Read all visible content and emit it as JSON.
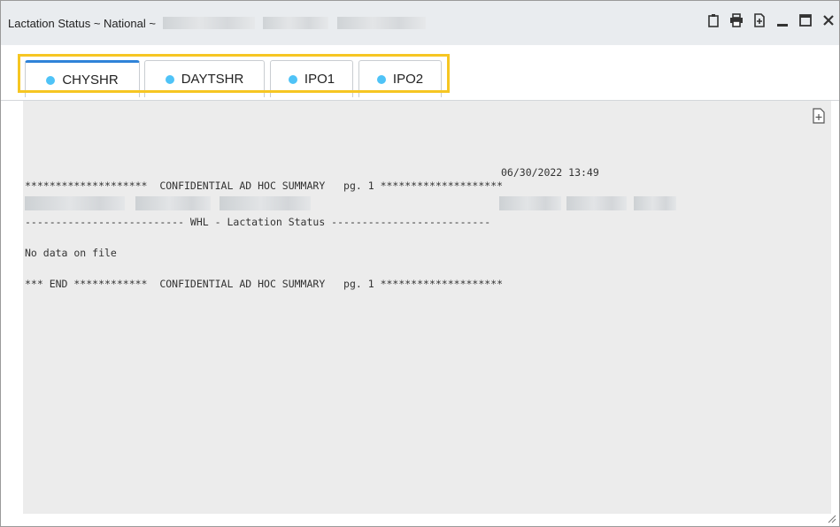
{
  "window": {
    "title": "Lactation Status ~ National ~",
    "title_redacted": true,
    "icons": [
      "clipboard-icon",
      "printer-icon",
      "export-icon",
      "minimize-icon",
      "maximize-icon",
      "close-icon"
    ]
  },
  "tabs": [
    {
      "label": "CHYSHR",
      "active": true
    },
    {
      "label": "DAYTSHR",
      "active": false
    },
    {
      "label": "IPO1",
      "active": false
    },
    {
      "label": "IPO2",
      "active": false
    }
  ],
  "report": {
    "datetime": "06/30/2022 13:49",
    "header_line": "********************  CONFIDENTIAL AD HOC SUMMARY   pg. 1 ********************",
    "section_line": "-------------------------- WHL - Lactation Status --------------------------",
    "empty_message": "No data on file",
    "footer_line": "*** END ************  CONFIDENTIAL AD HOC SUMMARY   pg. 1 ********************"
  },
  "colors": {
    "accent": "#2f83d8",
    "highlight": "#f6c622",
    "status_dot": "#4fc3f7",
    "content_bg": "#ececec"
  }
}
